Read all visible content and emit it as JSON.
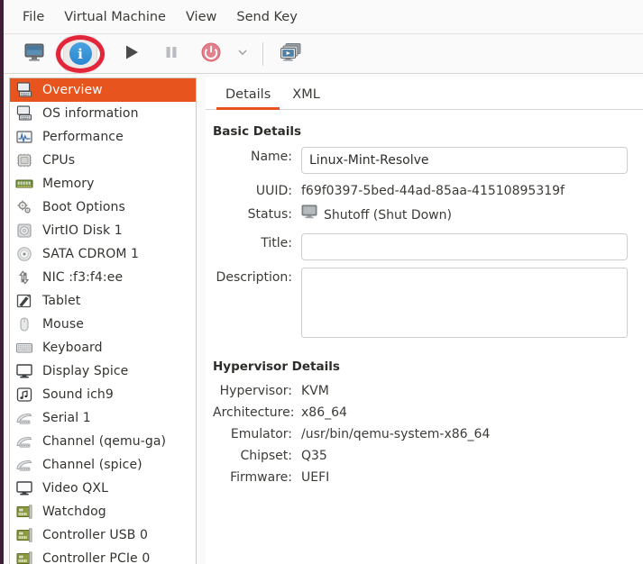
{
  "window": {
    "accent_color": "#e8541e",
    "highlight_ring_color": "#e3253a"
  },
  "menubar": {
    "items": [
      {
        "label": "File",
        "name": "menu-file"
      },
      {
        "label": "Virtual Machine",
        "name": "menu-virtual-machine"
      },
      {
        "label": "View",
        "name": "menu-view"
      },
      {
        "label": "Send Key",
        "name": "menu-send-key"
      }
    ]
  },
  "toolbar": {
    "console_title": "Show the graphical console",
    "info_title": "Show virtual hardware details",
    "run_title": "Run",
    "pause_title": "Pause",
    "shutdown_title": "Shut Down",
    "shutdown_menu_title": "Shut Down options",
    "snapshot_title": "Manage VM snapshots",
    "info_glyph": "i"
  },
  "sidebar": {
    "items": [
      {
        "label": "Overview",
        "icon": "computer-icon",
        "selected": true
      },
      {
        "label": "OS information",
        "icon": "computer-icon",
        "selected": false
      },
      {
        "label": "Performance",
        "icon": "performance-icon",
        "selected": false
      },
      {
        "label": "CPUs",
        "icon": "cpu-icon",
        "selected": false
      },
      {
        "label": "Memory",
        "icon": "memory-icon",
        "selected": false
      },
      {
        "label": "Boot Options",
        "icon": "gears-icon",
        "selected": false
      },
      {
        "label": "VirtIO Disk 1",
        "icon": "harddisk-icon",
        "selected": false
      },
      {
        "label": "SATA CDROM 1",
        "icon": "cdrom-icon",
        "selected": false
      },
      {
        "label": "NIC :f3:f4:ee",
        "icon": "network-icon",
        "selected": false
      },
      {
        "label": "Tablet",
        "icon": "tablet-icon",
        "selected": false
      },
      {
        "label": "Mouse",
        "icon": "mouse-icon",
        "selected": false
      },
      {
        "label": "Keyboard",
        "icon": "keyboard-icon",
        "selected": false
      },
      {
        "label": "Display Spice",
        "icon": "display-icon",
        "selected": false
      },
      {
        "label": "Sound ich9",
        "icon": "sound-icon",
        "selected": false
      },
      {
        "label": "Serial 1",
        "icon": "serial-icon",
        "selected": false
      },
      {
        "label": "Channel (qemu-ga)",
        "icon": "serial-icon",
        "selected": false
      },
      {
        "label": "Channel (spice)",
        "icon": "serial-icon",
        "selected": false
      },
      {
        "label": "Video QXL",
        "icon": "display-icon",
        "selected": false
      },
      {
        "label": "Watchdog",
        "icon": "pci-card-icon",
        "selected": false
      },
      {
        "label": "Controller USB 0",
        "icon": "pci-card-icon",
        "selected": false
      },
      {
        "label": "Controller PCIe 0",
        "icon": "pci-card-icon",
        "selected": false
      }
    ]
  },
  "details": {
    "tabs": [
      {
        "label": "Details",
        "active": true
      },
      {
        "label": "XML",
        "active": false
      }
    ],
    "basic_details": {
      "section_title": "Basic Details",
      "name_label": "Name:",
      "name_value": "Linux-Mint-Resolve",
      "uuid_label": "UUID:",
      "uuid_value": "f69f0397-5bed-44ad-85aa-41510895319f",
      "status_label": "Status:",
      "status_value": "Shutoff (Shut Down)",
      "title_label": "Title:",
      "title_value": "",
      "title_placeholder": "",
      "description_label": "Description:",
      "description_value": "",
      "description_placeholder": ""
    },
    "hypervisor_details": {
      "section_title": "Hypervisor Details",
      "rows": [
        {
          "label": "Hypervisor:",
          "value": "KVM"
        },
        {
          "label": "Architecture:",
          "value": "x86_64"
        },
        {
          "label": "Emulator:",
          "value": "/usr/bin/qemu-system-x86_64"
        },
        {
          "label": "Chipset:",
          "value": "Q35"
        },
        {
          "label": "Firmware:",
          "value": "UEFI"
        }
      ]
    }
  }
}
